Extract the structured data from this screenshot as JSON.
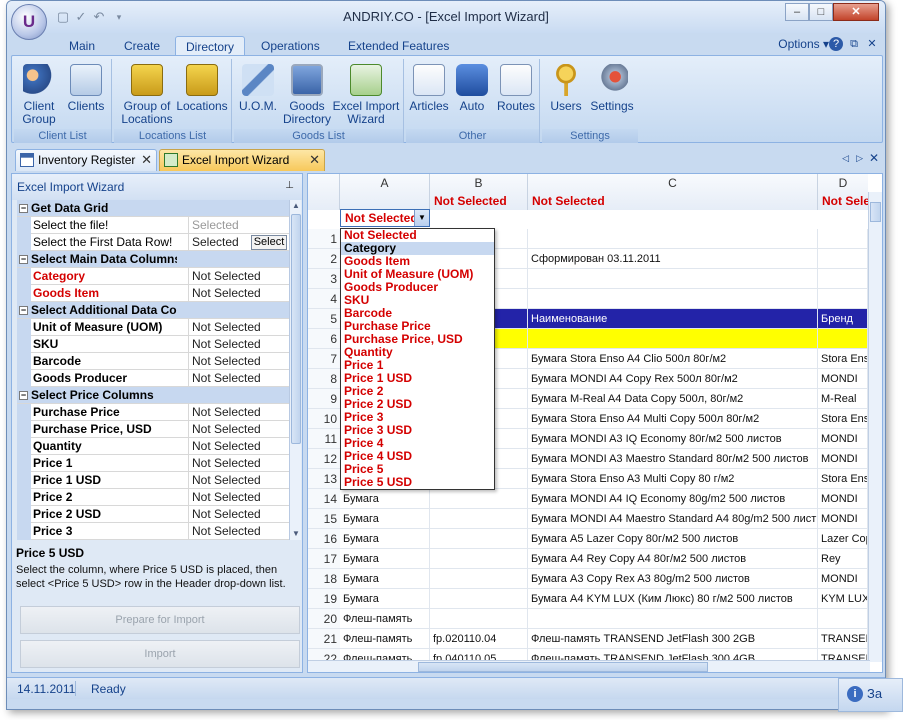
{
  "window": {
    "title": "ANDRIY.CO - [Excel Import Wizard]",
    "logo_letter": "U"
  },
  "ribbon_tabs": [
    "Main",
    "Create",
    "Directory",
    "Operations",
    "Extended Features"
  ],
  "options_label": "Options",
  "ribbon_groups": [
    {
      "label": "Client List",
      "buttons": [
        "Client Group",
        "Clients"
      ]
    },
    {
      "label": "Locations List",
      "buttons": [
        "Group of Locations",
        "Locations"
      ]
    },
    {
      "label": "Goods List",
      "buttons": [
        "U.O.M.",
        "Goods Directory",
        "Excel Import Wizard"
      ]
    },
    {
      "label": "Other",
      "buttons": [
        "Articles",
        "Auto",
        "Routes"
      ]
    },
    {
      "label": "Settings",
      "buttons": [
        "Users",
        "Settings"
      ]
    }
  ],
  "doc_tabs": [
    "Inventory Register",
    "Excel Import Wizard"
  ],
  "left_panel": {
    "title": "Excel Import Wizard",
    "rows": [
      {
        "type": "cat",
        "k": "Get Data Grid"
      },
      {
        "k": "Select the file!",
        "v": "Selected",
        "dim": true
      },
      {
        "k": "Select the First Data Row!",
        "v": "Selected",
        "btn": "Select"
      },
      {
        "type": "cat",
        "k": "Select Main Data Columns"
      },
      {
        "k": "Category",
        "v": "Not Selected",
        "red": true
      },
      {
        "k": "Goods Item",
        "v": "Not Selected",
        "red": true
      },
      {
        "type": "cat",
        "k": "Select Additional Data Columns"
      },
      {
        "k": "Unit of Measure (UOM)",
        "v": "Not Selected",
        "bold": true
      },
      {
        "k": "SKU",
        "v": "Not Selected",
        "bold": true
      },
      {
        "k": "Barcode",
        "v": "Not Selected",
        "bold": true
      },
      {
        "k": "Goods Producer",
        "v": "Not Selected",
        "bold": true
      },
      {
        "type": "cat",
        "k": "Select Price Columns"
      },
      {
        "k": "Purchase Price",
        "v": "Not Selected",
        "bold": true
      },
      {
        "k": "Purchase Price, USD",
        "v": "Not Selected",
        "bold": true
      },
      {
        "k": "Quantity",
        "v": "Not Selected",
        "bold": true
      },
      {
        "k": "Price 1",
        "v": "Not Selected",
        "bold": true
      },
      {
        "k": "Price 1 USD",
        "v": "Not Selected",
        "bold": true
      },
      {
        "k": "Price 2",
        "v": "Not Selected",
        "bold": true
      },
      {
        "k": "Price 2 USD",
        "v": "Not Selected",
        "bold": true
      },
      {
        "k": "Price 3",
        "v": "Not Selected",
        "bold": true
      }
    ],
    "desc_title": "Price 5 USD",
    "desc_text": "Select the column, where Price 5 USD is placed, then select <Price 5 USD> row in the Header drop-down list.",
    "btn_prepare": "Prepare for Import",
    "btn_import": "Import"
  },
  "grid": {
    "columns": [
      {
        "letter": "A",
        "sel": "Not Selected"
      },
      {
        "letter": "B",
        "sel": "Not Selected"
      },
      {
        "letter": "C",
        "sel": "Not Selected"
      },
      {
        "letter": "D",
        "sel": "Not Sele"
      }
    ],
    "rows": [
      {
        "n": "1",
        "a": "",
        "b": "",
        "c": "",
        "d": ""
      },
      {
        "n": "2",
        "a": "",
        "b": "",
        "c": "Сформирован 03.11.2011",
        "d": ""
      },
      {
        "n": "3",
        "a": "",
        "b": "",
        "c": "",
        "d": ""
      },
      {
        "n": "4",
        "a": "",
        "b": "",
        "c": "",
        "d": ""
      },
      {
        "n": "5",
        "a": "",
        "b": "",
        "c": "Наименование",
        "d": "Бренд",
        "bg": "#2323a8",
        "fg": "#ffffff"
      },
      {
        "n": "6",
        "a": "",
        "b": "",
        "c": "",
        "d": "",
        "bg": "#ffff00"
      },
      {
        "n": "7",
        "a": "",
        "b": "",
        "c": "Бумага Stora Enso A4 Clio 500л 80г/м2",
        "d": "Stora Enso"
      },
      {
        "n": "8",
        "a": "",
        "b": "",
        "c": "Бумага MONDI A4 Copy Rex 500л 80г/м2",
        "d": "MONDI"
      },
      {
        "n": "9",
        "a": "",
        "b": "р",
        "c": "Бумага M-Real A4 Data Copy 500л, 80г/м2",
        "d": "M-Real"
      },
      {
        "n": "10",
        "a": "",
        "b": "",
        "c": "Бумага Stora Enso A4 Multi Copy 500л 80г/м2",
        "d": "Stora Enso"
      },
      {
        "n": "11",
        "a": "",
        "b": "",
        "c": "Бумага MONDI A3 IQ Economy 80г/м2 500 листов",
        "d": "MONDI"
      },
      {
        "n": "12",
        "a": "",
        "b": "",
        "c": "Бумага MONDI A3 Maestro Standard 80г/м2 500 листов",
        "d": "MONDI"
      },
      {
        "n": "13",
        "a": "",
        "b": "",
        "c": "Бумага Stora Enso A3 Multi Copy 80 г/м2",
        "d": "Stora Enso"
      },
      {
        "n": "14",
        "a": "Бумага",
        "b": "",
        "c": "Бумага MONDI A4 IQ Economy 80g/m2 500 листов",
        "d": "MONDI"
      },
      {
        "n": "15",
        "a": "Бумага",
        "b": "",
        "c": "Бумага MONDI A4 Maestro Standard A4 80g/m2 500 лист",
        "d": "MONDI"
      },
      {
        "n": "16",
        "a": "Бумага",
        "b": "",
        "c": "Бумага A5 Lazer Copy 80г/м2 500 листов",
        "d": "Lazer Copy"
      },
      {
        "n": "17",
        "a": "Бумага",
        "b": "",
        "c": "Бумага A4 Rey Copy A4 80г/м2 500 листов",
        "d": "Rey"
      },
      {
        "n": "18",
        "a": "Бумага",
        "b": "",
        "c": "Бумага A3 Copy Rex A3 80g/m2 500 листов",
        "d": "MONDI"
      },
      {
        "n": "19",
        "a": "Бумага",
        "b": "",
        "c": "Бумага A4 KYM LUX (Ким Люкс) 80 г/м2 500 листов",
        "d": "KYM LUX"
      },
      {
        "n": "20",
        "a": "Флеш-память",
        "b": "",
        "c": "",
        "d": ""
      },
      {
        "n": "21",
        "a": "Флеш-память",
        "b": "fp.020110.04",
        "c": "Флеш-память TRANSEND JetFlash 300 2GB",
        "d": "TRANSEND"
      },
      {
        "n": "22",
        "a": "Флеш-память",
        "b": "fp.040110.05",
        "c": "Флеш-память TRANSEND JetFlash 300 4GB",
        "d": "TRANSEND"
      }
    ],
    "dropdown": [
      "Not Selected",
      "Category",
      "Goods Item",
      "Unit of Measure (UOM)",
      "Goods Producer",
      "SKU",
      "Barcode",
      "Purchase Price",
      "Purchase Price, USD",
      "Quantity",
      "Price 1",
      "Price 1 USD",
      "Price 2",
      "Price 2 USD",
      "Price 3",
      "Price 3 USD",
      "Price 4",
      "Price 4 USD",
      "Price 5",
      "Price 5 USD"
    ],
    "dropdown_highlight": 1
  },
  "status": {
    "date": "14.11.2011",
    "text": "Ready"
  },
  "ext_label": "За"
}
